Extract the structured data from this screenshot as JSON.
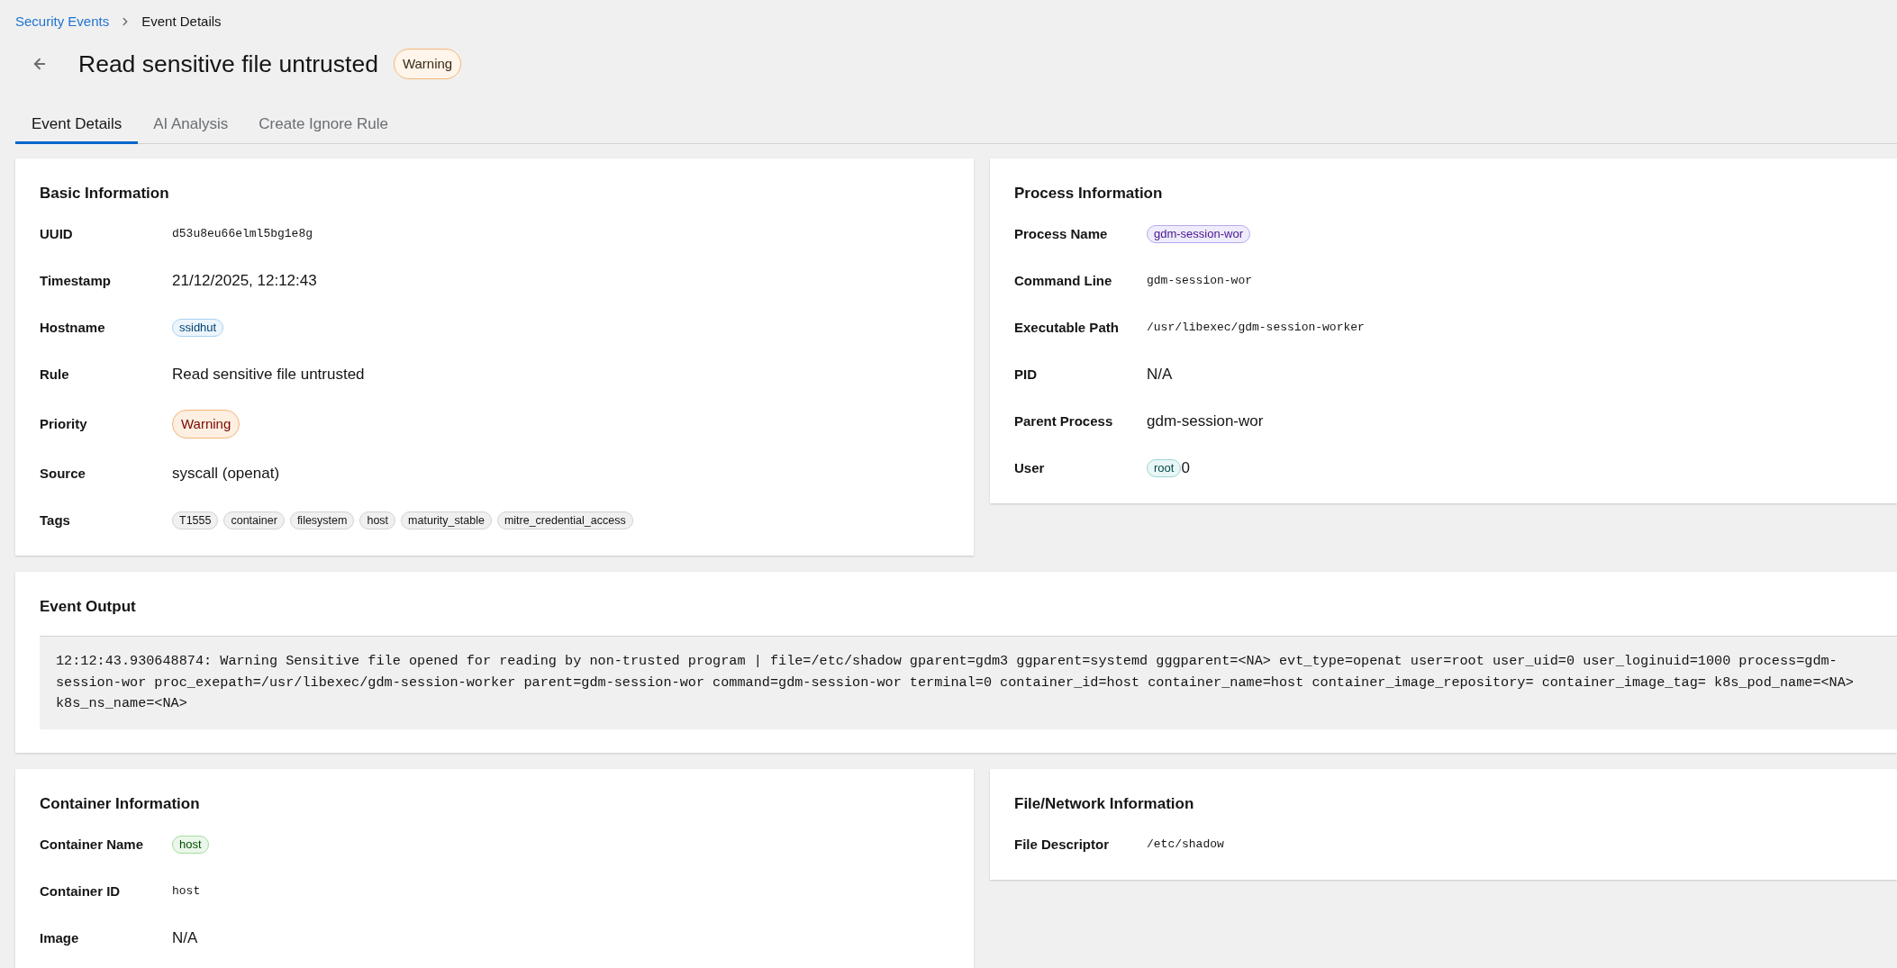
{
  "breadcrumb": [
    {
      "label": "Security Events",
      "kind": "link"
    },
    {
      "label": "Event Details",
      "kind": "current"
    }
  ],
  "header": {
    "title": "Read sensitive file untrusted",
    "badge": "Warning"
  },
  "tabs": [
    {
      "label": "Event Details",
      "selected": true
    },
    {
      "label": "AI Analysis",
      "selected": false
    },
    {
      "label": "Create Ignore Rule",
      "selected": false
    }
  ],
  "basic_information": {
    "title": "Basic Information",
    "rows": [
      {
        "label": "UUID",
        "kind": "mono",
        "value": "d53u8eu66elml5bg1e8g"
      },
      {
        "label": "Timestamp",
        "kind": "text",
        "value": "21/12/2025, 12:12:43"
      },
      {
        "label": "Hostname",
        "kind": "tag",
        "value": "ssidhut",
        "color": "#a8d1f2"
      },
      {
        "label": "Rule",
        "kind": "text",
        "value": "Read sensitive file untrusted"
      },
      {
        "label": "Priority",
        "kind": "priority",
        "value": "Warning",
        "color": "#f4b678"
      },
      {
        "label": "Source",
        "kind": "text",
        "value": "syscall (openat)"
      },
      {
        "label": "Tags",
        "kind": "tags",
        "values": [
          "T1555",
          "container",
          "filesystem",
          "host",
          "maturity_stable",
          "mitre_credential_access"
        ]
      }
    ]
  },
  "process_information": {
    "title": "Process Information",
    "rows": [
      {
        "label": "Process Name",
        "kind": "tag",
        "value": "gdm-session-wor",
        "color": "#b8a9ef"
      },
      {
        "label": "Command Line",
        "kind": "mono",
        "value": "gdm-session-wor"
      },
      {
        "label": "Executable Path",
        "kind": "mono",
        "value": "/usr/libexec/gdm-session-worker"
      },
      {
        "label": "PID",
        "kind": "text",
        "value": "N/A"
      },
      {
        "label": "Parent Process",
        "kind": "text",
        "value": "gdm-session-wor"
      },
      {
        "label": "User",
        "kind": "user",
        "tag": "root",
        "color": "#9ad6d3",
        "value": "0"
      }
    ]
  },
  "event_output": {
    "title": "Event Output",
    "text": "12:12:43.930648874: Warning Sensitive file opened for reading by non-trusted program | file=/etc/shadow gparent=gdm3 ggparent=systemd gggparent=<NA> evt_type=openat user=root user_uid=0 user_loginuid=1000 process=gdm-session-wor proc_exepath=/usr/libexec/gdm-session-worker parent=gdm-session-wor command=gdm-session-wor terminal=0 container_id=host container_name=host container_image_repository= container_image_tag= k8s_pod_name=<NA> k8s_ns_name=<NA>"
  },
  "container_information": {
    "title": "Container Information",
    "rows": [
      {
        "label": "Container Name",
        "kind": "tag",
        "value": "host",
        "color": "#a6dba0"
      },
      {
        "label": "Container ID",
        "kind": "mono",
        "value": "host"
      },
      {
        "label": "Image",
        "kind": "text",
        "value": "N/A"
      }
    ]
  },
  "file_network_information": {
    "title": "File/Network Information",
    "rows": [
      {
        "label": "File Descriptor",
        "kind": "mono",
        "value": "/etc/shadow"
      }
    ]
  }
}
